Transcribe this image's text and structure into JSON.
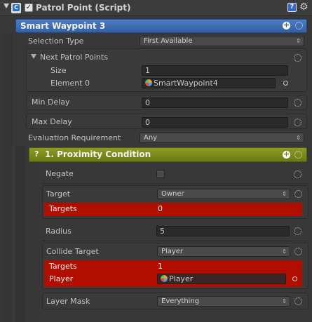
{
  "header": {
    "enabled": true,
    "title": "Patrol Point (Script)"
  },
  "waypoint_bar": {
    "title": "Smart Waypoint 3"
  },
  "selection_type": {
    "label": "Selection Type",
    "value": "First Available"
  },
  "next_patrol_points": {
    "label": "Next Patrol Points",
    "size_label": "Size",
    "size_value": "1",
    "element_label": "Element 0",
    "element_value": "SmartWaypoint4"
  },
  "min_delay": {
    "label": "Min Delay",
    "value": "0"
  },
  "max_delay": {
    "label": "Max Delay",
    "value": "0"
  },
  "evaluation": {
    "label": "Evaluation Requirement",
    "value": "Any"
  },
  "condition": {
    "help": "?",
    "title": "1. Proximity Condition",
    "negate_label": "Negate",
    "negate_checked": false,
    "target_label": "Target",
    "target_value": "Owner",
    "targets_error_label": "Targets",
    "targets_error_value": "0",
    "radius_label": "Radius",
    "radius_value": "5",
    "collide_label": "Collide Target",
    "collide_value": "Player",
    "collide_targets_label": "Targets",
    "collide_targets_value": "1",
    "player_label": "Player",
    "player_value": "Player",
    "layer_label": "Layer Mask",
    "layer_value": "Everything"
  },
  "colors": {
    "waypoint_bar": "#3d6bb0",
    "condition_bar": "#7a8a1a",
    "error_row": "#b20e00"
  }
}
